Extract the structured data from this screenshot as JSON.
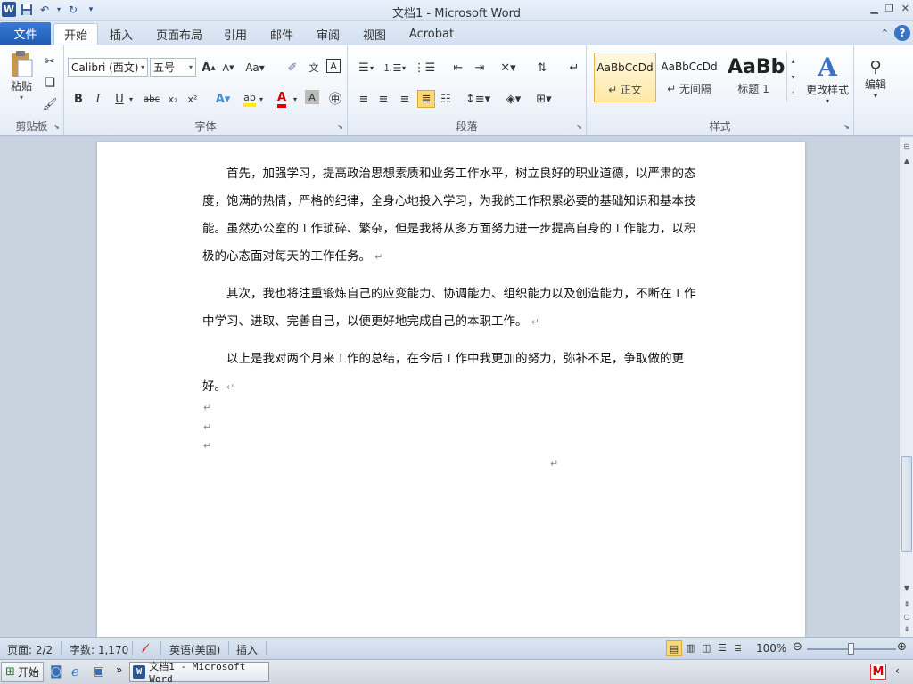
{
  "window": {
    "title": "文档1 - Microsoft Word"
  },
  "tabs": {
    "file": "文件",
    "items": [
      "开始",
      "插入",
      "页面布局",
      "引用",
      "邮件",
      "审阅",
      "视图",
      "Acrobat"
    ],
    "active": "开始"
  },
  "ribbon": {
    "clipboard": {
      "label": "剪贴板",
      "paste": "粘贴"
    },
    "font": {
      "label": "字体",
      "font_name": "Calibri (西文)",
      "font_size": "五号"
    },
    "paragraph": {
      "label": "段落"
    },
    "styles": {
      "label": "样式",
      "items": [
        {
          "preview": "AaBbCcDd",
          "name": "↵ 正文"
        },
        {
          "preview": "AaBbCcDd",
          "name": "↵ 无间隔"
        },
        {
          "preview": "AaBb",
          "name": "标题 1"
        }
      ],
      "change": "更改样式"
    },
    "editing": {
      "label": "编辑"
    }
  },
  "document": {
    "paragraphs": [
      "首先，加强学习，提高政治思想素质和业务工作水平，树立良好的职业道德，以严肃的态度，饱满的热情，严格的纪律，全身心地投入学习，为我的工作积累必要的基础知识和基本技能。虽然办公室的工作琐碎、繁杂，但是我将从多方面努力进一步提高自身的工作能力，以积极的心态面对每天的工作任务。",
      "其次，我也将注重锻炼自己的应变能力、协调能力、组织能力以及创造能力，不断在工作中学习、进取、完善自己，以便更好地完成自己的本职工作。",
      "以上是我对两个月来工作的总结，在今后工作中我更加的努力，弥补不足，争取做的更好。"
    ],
    "paragraph_mark": "↵"
  },
  "statusbar": {
    "page": "页面: 2/2",
    "words": "字数: 1,170",
    "language": "英语(美国)",
    "mode": "插入",
    "zoom": "100%",
    "zoom_level": 1.0
  },
  "taskbar": {
    "start": "开始",
    "item": "文档1 - Microsoft Word"
  }
}
